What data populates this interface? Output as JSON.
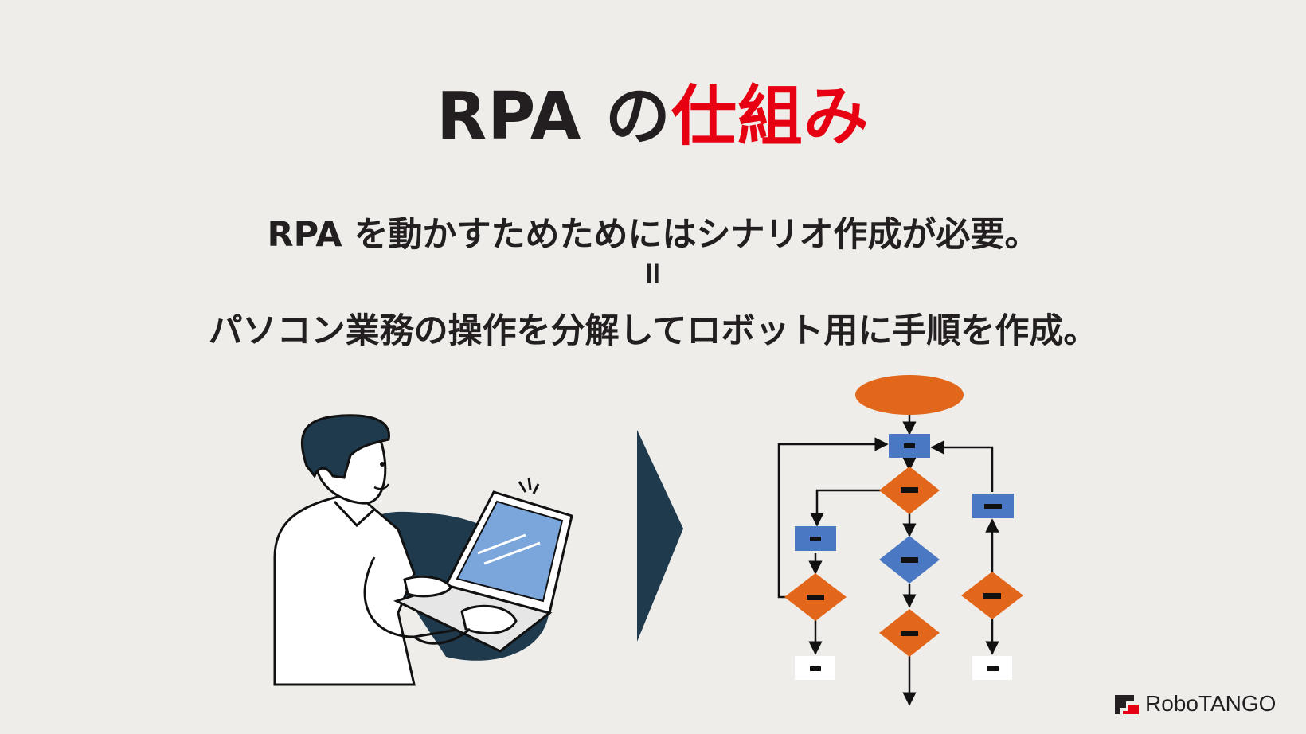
{
  "title": {
    "part1": "RPA の",
    "part2": "仕組み"
  },
  "lines": {
    "line1": "RPA を動かすためためにはシナリオ作成が必要。",
    "equals": "=",
    "line2": "パソコン業務の操作を分解してロボット用に手順を作成。"
  },
  "logo": {
    "text": "RoboTANGO"
  },
  "colors": {
    "accent": "#e60012",
    "orange": "#e2671a",
    "blue": "#4a78c2",
    "navy": "#1f3a4d",
    "text": "#231f20",
    "background": "#efedea"
  }
}
